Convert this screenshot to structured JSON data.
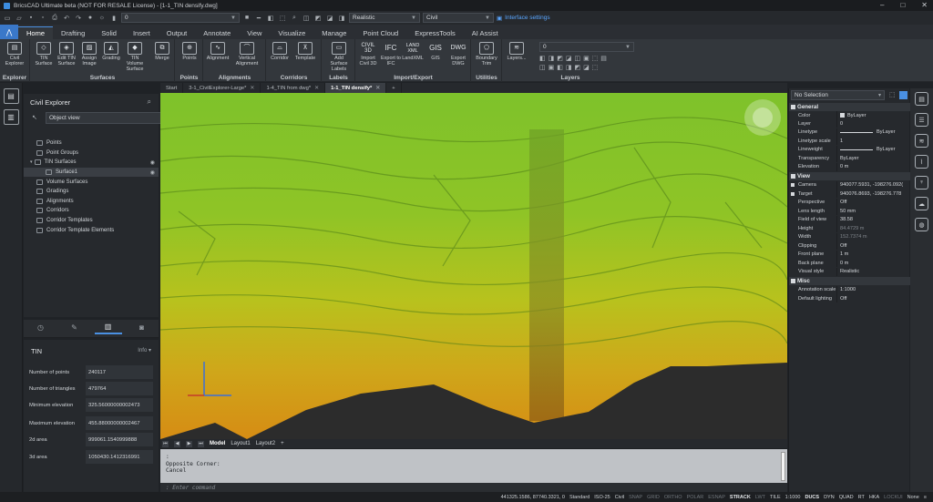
{
  "window": {
    "title": "BricsCAD Ultimate beta (NOT FOR RESALE License) - [1-1_TIN densify.dwg]",
    "controls": [
      "–",
      "□",
      "✕"
    ]
  },
  "quick_access": {
    "layer_value": "0",
    "visual_style": "Realistic",
    "workspace": "Civil",
    "interface_settings": "Interface settings"
  },
  "ribbon_tabs": [
    "Home",
    "Drafting",
    "Solid",
    "Insert",
    "Output",
    "Annotate",
    "View",
    "Visualize",
    "Manage",
    "Point Cloud",
    "ExpressTools",
    "AI Assist"
  ],
  "ribbon": {
    "groups": [
      {
        "label": "Explorer",
        "buttons": [
          "Civil Explorer"
        ]
      },
      {
        "label": "Surfaces",
        "buttons": [
          "TIN Surface",
          "Edit TIN Surface",
          "Assign Image",
          "Grading",
          "TIN Volume Surface",
          "Merge"
        ]
      },
      {
        "label": "Points",
        "buttons": [
          "Points"
        ]
      },
      {
        "label": "Alignments",
        "buttons": [
          "Alignment",
          "Vertical Alignment"
        ]
      },
      {
        "label": "Corridors",
        "buttons": [
          "Corridor",
          "Template"
        ]
      },
      {
        "label": "Labels",
        "buttons": [
          "Add Surface Labels"
        ]
      },
      {
        "label": "Import/Export",
        "buttons": [
          "Import Civil 3D",
          "Export to IFC",
          "LandXML",
          "GIS",
          "Export DWG"
        ]
      },
      {
        "label": "Utilities",
        "buttons": [
          "Boundary Trim"
        ]
      },
      {
        "label": "Layers",
        "buttons": [
          "Layers..."
        ]
      }
    ],
    "layers_combo": "0",
    "icon_text": {
      "civil3d": "CIVIL 3D",
      "ifc": "IFC",
      "landxml": "LAND XML",
      "gis": "GIS",
      "dwg": "DWG"
    }
  },
  "civil_explorer": {
    "title": "Civil Explorer",
    "view_mode": "Object view",
    "tree": [
      {
        "label": "Points",
        "indent": 1
      },
      {
        "label": "Point Groups",
        "indent": 1
      },
      {
        "label": "TIN Surfaces",
        "indent": 0,
        "expanded": true
      },
      {
        "label": "Surface1",
        "indent": 2,
        "selected": true
      },
      {
        "label": "Volume Surfaces",
        "indent": 1
      },
      {
        "label": "Gradings",
        "indent": 1
      },
      {
        "label": "Alignments",
        "indent": 1
      },
      {
        "label": "Corridors",
        "indent": 1
      },
      {
        "label": "Corridor Templates",
        "indent": 1
      },
      {
        "label": "Corridor Template Elements",
        "indent": 1
      }
    ]
  },
  "tin_panel": {
    "title": "TIN",
    "info": "Info",
    "rows": [
      {
        "key": "Number of points",
        "value": "240117"
      },
      {
        "key": "Number of triangles",
        "value": "479764"
      },
      {
        "key": "Minimum elevation",
        "value": "325.56000000002473"
      },
      {
        "key": "Maximum elevation",
        "value": "455.88000000002467"
      },
      {
        "key": "2d area",
        "value": "999061.1540999888"
      },
      {
        "key": "3d area",
        "value": "1050430.1412316991"
      }
    ]
  },
  "doc_tabs": [
    {
      "label": "Start"
    },
    {
      "label": "3-1_CivilExplorer-Large*"
    },
    {
      "label": "1-4_TIN from dwg*"
    },
    {
      "label": "1-1_TIN densify*",
      "active": true
    }
  ],
  "layout_tabs": [
    "Model",
    "Layout1",
    "Layout2"
  ],
  "command_line": {
    "history": [
      ":",
      "Opposite Corner:",
      "Cancel"
    ],
    "placeholder": ": Enter command"
  },
  "properties": {
    "selection": "No Selection",
    "sections": [
      {
        "name": "General",
        "rows": [
          {
            "key": "Color",
            "value": "ByLayer"
          },
          {
            "key": "Layer",
            "value": "0"
          },
          {
            "key": "Linetype",
            "value": "ByLayer"
          },
          {
            "key": "Linetype scale",
            "value": "1"
          },
          {
            "key": "Lineweight",
            "value": "ByLayer"
          },
          {
            "key": "Transparency",
            "value": "ByLayer"
          },
          {
            "key": "Elevation",
            "value": "0 m"
          }
        ]
      },
      {
        "name": "View",
        "rows": [
          {
            "key": "Camera",
            "value": "940077.5931, -198276.092("
          },
          {
            "key": "Target",
            "value": "940076.8693, -198276.778"
          },
          {
            "key": "Perspective",
            "value": "Off"
          },
          {
            "key": "Lens length",
            "value": "50 mm"
          },
          {
            "key": "Field of view",
            "value": "38.58"
          },
          {
            "key": "Height",
            "value": "84.4729 m"
          },
          {
            "key": "Width",
            "value": "152.7374 m"
          },
          {
            "key": "Clipping",
            "value": "Off"
          },
          {
            "key": "Front plane",
            "value": "1 m"
          },
          {
            "key": "Back plane",
            "value": "0 m"
          },
          {
            "key": "Visual style",
            "value": "Realistic"
          }
        ]
      },
      {
        "name": "Misc",
        "rows": [
          {
            "key": "Annotation scale",
            "value": "1:1000"
          },
          {
            "key": "Default lighting",
            "value": "Off"
          }
        ]
      }
    ]
  },
  "status_bar": {
    "coordinates": "441325.1586, 87740.3321, 0",
    "items": [
      "Standard",
      "ISO-25",
      "Civil",
      "SNAP",
      "GRID",
      "ORTHO",
      "POLAR",
      "ESNAP",
      "STRACK",
      "LWT",
      "TILE",
      "1:1000",
      "DUCS",
      "DYN",
      "QUAD",
      "RT",
      "HKA",
      "LOCKUI",
      "None"
    ]
  },
  "colors": {
    "accent": "#4a90e2",
    "terrain_high": "#7cc22a",
    "terrain_mid": "#b9c51d",
    "terrain_low": "#d6a21a",
    "ground": "#2b2b2b"
  }
}
